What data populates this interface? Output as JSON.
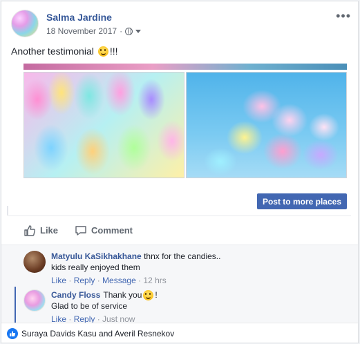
{
  "post": {
    "author": "Salma Jardine",
    "date": "18 November 2017",
    "text_before": "Another testimonial",
    "text_after": "!!!"
  },
  "share_button": {
    "label": "Post to more places"
  },
  "actions": {
    "like": "Like",
    "comment": "Comment"
  },
  "comments": [
    {
      "author": "Matyulu KaSikhakhane",
      "text_line1": "thnx for the candies..",
      "text_line2": "kids really enjoyed them",
      "like": "Like",
      "reply": "Reply",
      "message": "Message",
      "time": "12 hrs"
    },
    {
      "author": "Candy Floss",
      "text_line1": "Thank you",
      "text_after": "!",
      "text_line2": "Glad to be of service",
      "like": "Like",
      "reply": "Reply",
      "time": "Just now"
    }
  ],
  "footer": {
    "likers": "Suraya Davids Kasu and Averil Resnekov"
  },
  "colors": {
    "link": "#365899",
    "button": "#4267b2",
    "like_badge": "#1877f2"
  },
  "icons": [
    "globe-icon",
    "dropdown-caret-icon",
    "more-options-icon",
    "thumbs-up-icon",
    "comment-bubble-icon",
    "smiley-emoji-icon",
    "like-badge-icon"
  ]
}
